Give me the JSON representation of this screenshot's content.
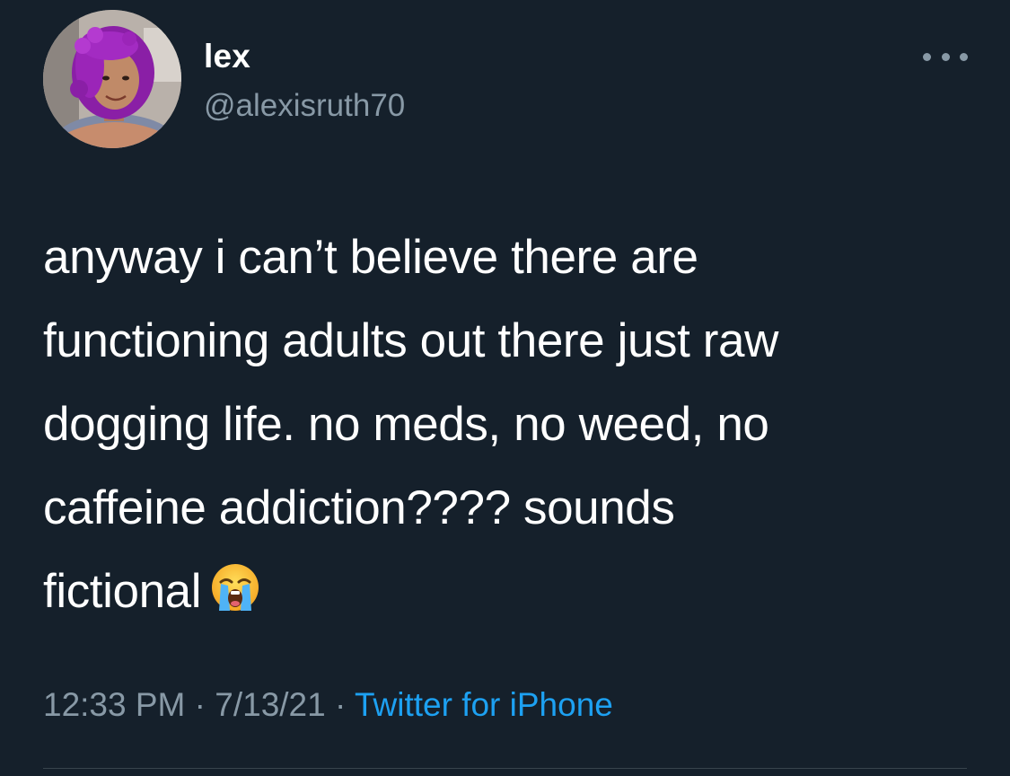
{
  "author": {
    "display_name": "lex",
    "handle": "@alexisruth70"
  },
  "tweet": {
    "text": "anyway i can’t believe there are\nfunctioning adults out there just raw\ndogging life. no meds, no weed, no\ncaffeine addiction???? sounds\nfictional",
    "emoji": "loudly-crying-face-emoji"
  },
  "meta": {
    "time": "12:33 PM",
    "separator": "·",
    "date": "7/13/21",
    "source": "Twitter for iPhone"
  },
  "icons": {
    "more": "more-horizontal-icon",
    "avatar": "profile-avatar"
  },
  "colors": {
    "background": "#15202b",
    "primary_text": "#ffffff",
    "secondary_text": "#8899a6",
    "link": "#1da1f2",
    "divider": "#38444d"
  }
}
